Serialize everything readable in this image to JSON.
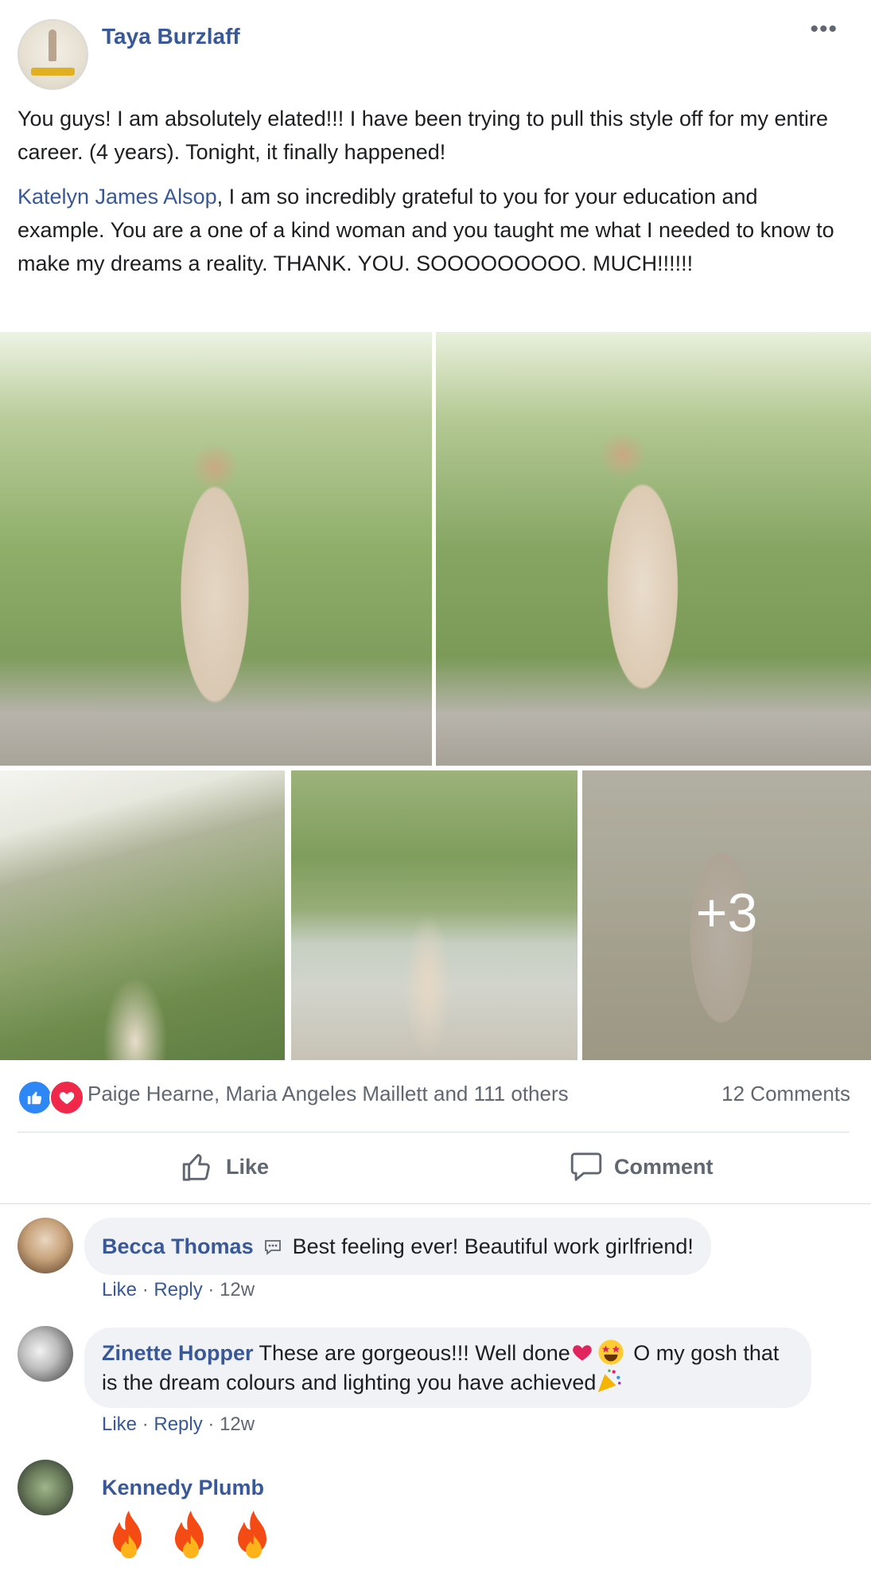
{
  "post": {
    "author": "Taya Burzlaff",
    "more_label": "•••",
    "paragraph1": "You guys! I am absolutely elated!!! I have been trying to pull this style off for my entire career. (4 years). Tonight, it finally happened!",
    "mention": "Katelyn James Alsop",
    "paragraph2_rest": ", I am so incredibly grateful to you for your education and example. You are a one of a kind woman and you taught me what I needed to know to make my dreams a reality. THANK. YOU. SOOOOOOOOO. MUCH!!!!!!",
    "more_photos_label": "+3"
  },
  "reactions": {
    "summary": "Paige Hearne, Maria Angeles Maillett and 111 others",
    "comments_count": "12 Comments",
    "like_icon": "thumbs-up-icon",
    "love_icon": "heart-icon"
  },
  "actions": {
    "like_label": "Like",
    "comment_label": "Comment"
  },
  "comments": [
    {
      "name": "Becca Thomas",
      "text": "Best feeling ever! Beautiful work girlfriend!",
      "like": "Like",
      "reply": "Reply",
      "time": "12w",
      "sep": "·"
    },
    {
      "name": "Zinette Hopper",
      "text_a": "These are gorgeous!!! Well done",
      "text_b": "O my gosh that is the dream colours and lighting you have achieved",
      "like": "Like",
      "reply": "Reply",
      "time": "12w",
      "sep": "·"
    },
    {
      "name": "Kennedy Plumb",
      "emoji": "fire-icon"
    }
  ],
  "colors": {
    "link": "#385898",
    "muted": "#606770",
    "bubble": "#f0f2f5",
    "like_blue": "#2d87f5",
    "love_red": "#f0284a"
  }
}
